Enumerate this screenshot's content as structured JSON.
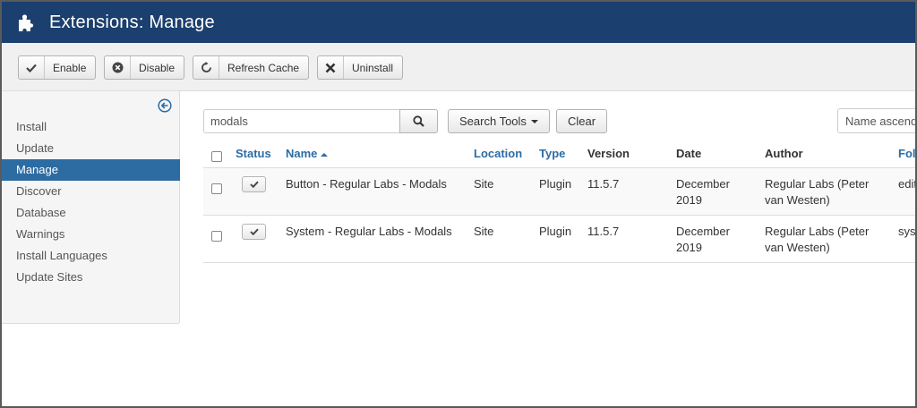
{
  "header": {
    "title": "Extensions: Manage",
    "icon": "puzzle-icon"
  },
  "toolbar": {
    "enable": "Enable",
    "disable": "Disable",
    "refresh_cache": "Refresh Cache",
    "uninstall": "Uninstall"
  },
  "sidebar": {
    "items": [
      {
        "label": "Install"
      },
      {
        "label": "Update"
      },
      {
        "label": "Manage"
      },
      {
        "label": "Discover"
      },
      {
        "label": "Database"
      },
      {
        "label": "Warnings"
      },
      {
        "label": "Install Languages"
      },
      {
        "label": "Update Sites"
      }
    ],
    "active": "Manage"
  },
  "filters": {
    "search_value": "modals",
    "search_tools": "Search Tools",
    "clear": "Clear",
    "sort": "Name ascending"
  },
  "table": {
    "headers": {
      "status": "Status",
      "name": "Name",
      "location": "Location",
      "type": "Type",
      "version": "Version",
      "date": "Date",
      "author": "Author",
      "folder": "Folder"
    },
    "rows": [
      {
        "name": "Button - Regular Labs - Modals",
        "location": "Site",
        "type": "Plugin",
        "version": "11.5.7",
        "date_line1": "December",
        "date_line2": "2019",
        "author_line1": "Regular Labs (Peter",
        "author_line2": "van Westen)",
        "folder": "editors-xtd"
      },
      {
        "name": "System - Regular Labs - Modals",
        "location": "Site",
        "type": "Plugin",
        "version": "11.5.7",
        "date_line1": "December",
        "date_line2": "2019",
        "author_line1": "Regular Labs (Peter",
        "author_line2": "van Westen)",
        "folder": "system"
      }
    ]
  },
  "colors": {
    "header_bg": "#1b3f6e",
    "active_sidebar": "#2d6ca2",
    "link": "#2a6ca5"
  }
}
